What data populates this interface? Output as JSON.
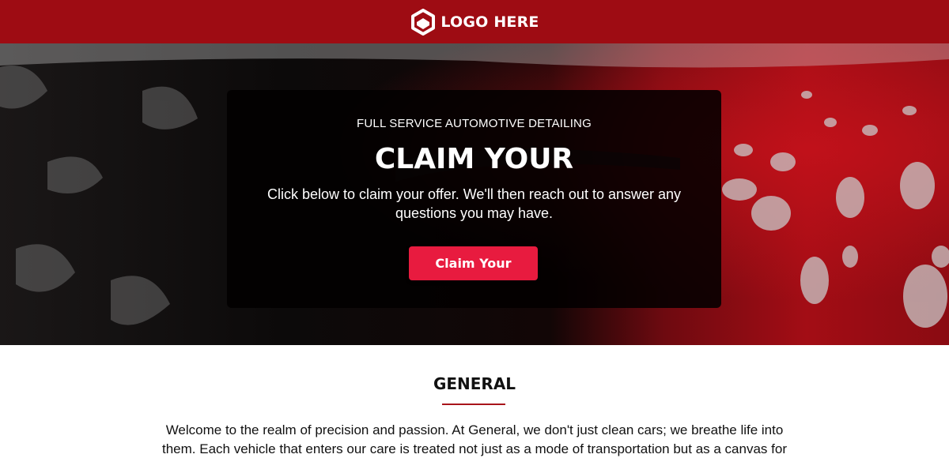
{
  "header": {
    "logo_text": "LOGO HERE",
    "logo_icon": "hexagon-logo-icon",
    "background_color": "#9e0c13"
  },
  "hero": {
    "eyebrow": "FULL SERVICE AUTOMOTIVE DETAILING",
    "title": "CLAIM YOUR",
    "description": "Click below to claim your offer. We'll then reach out to answer any questions you may have.",
    "button_label": "Claim Your",
    "button_color": "#e81b3f",
    "background_image": "red car with soap foam"
  },
  "general": {
    "title": "GENERAL",
    "divider_color": "#a8141b",
    "body": "Welcome to the realm of precision and passion. At General, we don't just clean cars; we breathe life into them. Each vehicle that enters our care is treated not just as a mode of transportation but as a canvas for craftsmanship. Get"
  }
}
